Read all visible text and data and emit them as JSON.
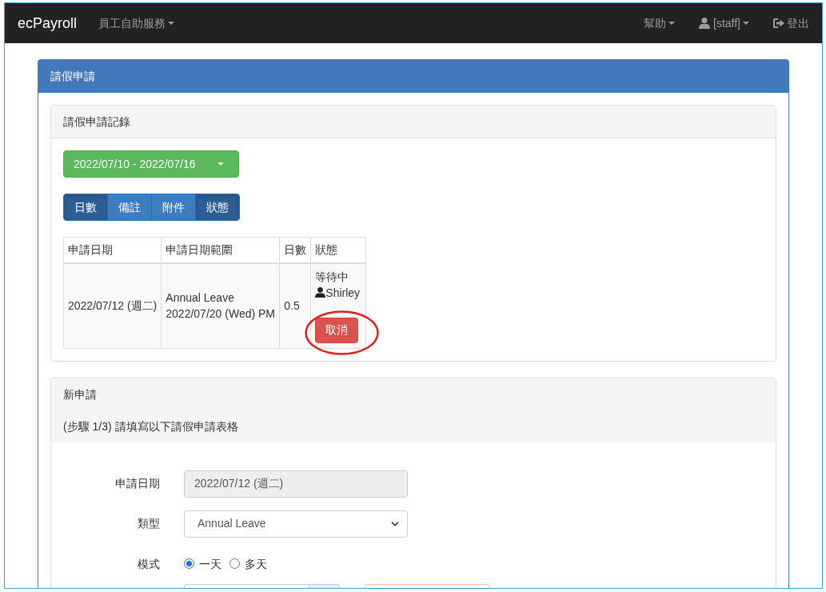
{
  "navbar": {
    "brand": "ecPayroll",
    "left_menu": [
      {
        "label": "員工自助服務",
        "kind": "dropdown"
      }
    ],
    "right_menu": [
      {
        "label": "幫助",
        "kind": "dropdown"
      },
      {
        "label": "[staff]",
        "kind": "user"
      },
      {
        "label": "登出",
        "kind": "logout"
      }
    ]
  },
  "main_panel": {
    "title": "請假申請"
  },
  "records": {
    "title": "請假申請記錄",
    "date_range": "2022/07/10 - 2022/07/16",
    "column_toggles": [
      {
        "label": "日數",
        "selected": true
      },
      {
        "label": "備註",
        "selected": false
      },
      {
        "label": "附件",
        "selected": false
      },
      {
        "label": "狀態",
        "selected": true
      }
    ],
    "table": {
      "columns": [
        "申請日期",
        "申請日期範圍",
        "日數",
        "狀態"
      ],
      "rows": [
        {
          "date": "2022/07/12 (週二)",
          "leave_type": "Annual Leave",
          "period": "2022/07/20 (Wed) PM",
          "days": "0.5",
          "status": "等待中",
          "approver": "Shirley",
          "action": "取消",
          "highlighted": true
        }
      ]
    }
  },
  "new_request": {
    "title": "新申請",
    "step_note": "(步驟 1/3) 請填寫以下請假申請表格",
    "fields": [
      {
        "kind": "text",
        "label": "申請日期",
        "value": "2022/07/12 (週二)",
        "disabled": true
      },
      {
        "kind": "select",
        "label": "類型",
        "value": "Annual Leave"
      },
      {
        "kind": "radio",
        "label": "模式",
        "options": [
          {
            "label": "一天",
            "selected": true
          },
          {
            "label": "多天",
            "selected": false
          }
        ]
      },
      {
        "kind": "input_pair"
      }
    ]
  }
}
